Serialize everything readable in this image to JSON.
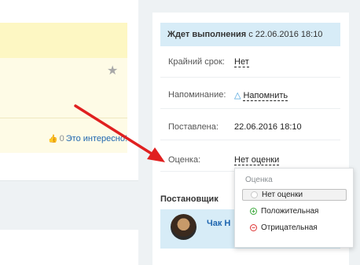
{
  "left": {
    "interest_count": "0",
    "interest_link": "Это интересно!"
  },
  "status": {
    "label": "Ждет выполнения",
    "date": "с 22.06.2016 18:10"
  },
  "fields": {
    "deadline_label": "Крайний срок:",
    "deadline_value": "Нет",
    "reminder_label": "Напоминание:",
    "reminder_value": "Напомнить",
    "created_label": "Поставлена:",
    "created_value": "22.06.2016 18:10",
    "rating_label": "Оценка:",
    "rating_value": "Нет оценки"
  },
  "creator": {
    "section_title": "Постановщик",
    "name": "Чак Н"
  },
  "rating_popup": {
    "title": "Оценка",
    "options": [
      "Нет оценки",
      "Положительная",
      "Отрицательная"
    ],
    "selected": "Нет оценки"
  },
  "colors": {
    "status_bg": "#d7ecf7",
    "link": "#2067b0",
    "arrow": "#e02020",
    "positive": "#3aa83a",
    "negative": "#dd3333"
  },
  "icons": [
    "star-icon",
    "like-icon",
    "bell-icon",
    "avatar",
    "arrow"
  ]
}
